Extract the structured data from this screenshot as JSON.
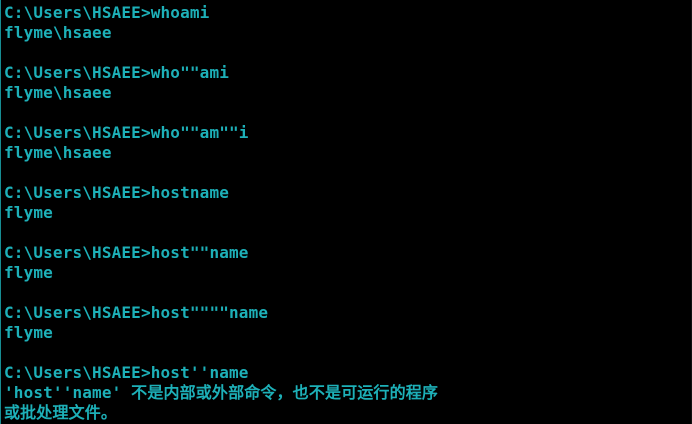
{
  "terminal": {
    "lines": [
      "C:\\Users\\HSAEE>whoami",
      "flyme\\hsaee",
      "",
      "C:\\Users\\HSAEE>who\"\"ami",
      "flyme\\hsaee",
      "",
      "C:\\Users\\HSAEE>who\"\"am\"\"i",
      "flyme\\hsaee",
      "",
      "C:\\Users\\HSAEE>hostname",
      "flyme",
      "",
      "C:\\Users\\HSAEE>host\"\"name",
      "flyme",
      "",
      "C:\\Users\\HSAEE>host\"\"\"\"name",
      "flyme",
      "",
      "C:\\Users\\HSAEE>host''name",
      "'host''name' 不是内部或外部命令，也不是可运行的程序",
      "或批处理文件。"
    ],
    "text_color": "#1db0b8",
    "background": "#000000"
  }
}
